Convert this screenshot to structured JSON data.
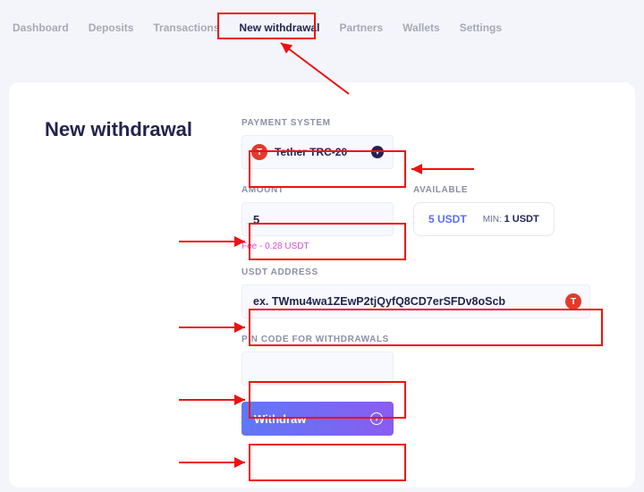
{
  "nav": {
    "items": [
      {
        "label": "Dashboard",
        "active": false
      },
      {
        "label": "Deposits",
        "active": false
      },
      {
        "label": "Transactions",
        "active": false
      },
      {
        "label": "New withdrawal",
        "active": true
      },
      {
        "label": "Partners",
        "active": false
      },
      {
        "label": "Wallets",
        "active": false
      },
      {
        "label": "Settings",
        "active": false
      }
    ]
  },
  "page": {
    "title": "New withdrawal"
  },
  "form": {
    "payment_system": {
      "label": "PAYMENT SYSTEM",
      "selected": "Tether TRC-20",
      "icon_letter": "T"
    },
    "amount": {
      "label": "AMOUNT",
      "value": "5",
      "fee_text": "Fee - 0.28 USDT"
    },
    "available": {
      "label": "AVAILABLE",
      "value": "5 USDT",
      "min_label": "MIN:",
      "min_value": "1 USDT"
    },
    "address": {
      "label": "USDT ADDRESS",
      "placeholder": "ex. TWmu4wa1ZEwP2tjQyfQ8CD7erSFDv8oScb",
      "icon_letter": "T"
    },
    "pin": {
      "label": "PIN CODE FOR WITHDRAWALS",
      "value": ""
    },
    "submit": {
      "label": "Withdraw"
    }
  }
}
